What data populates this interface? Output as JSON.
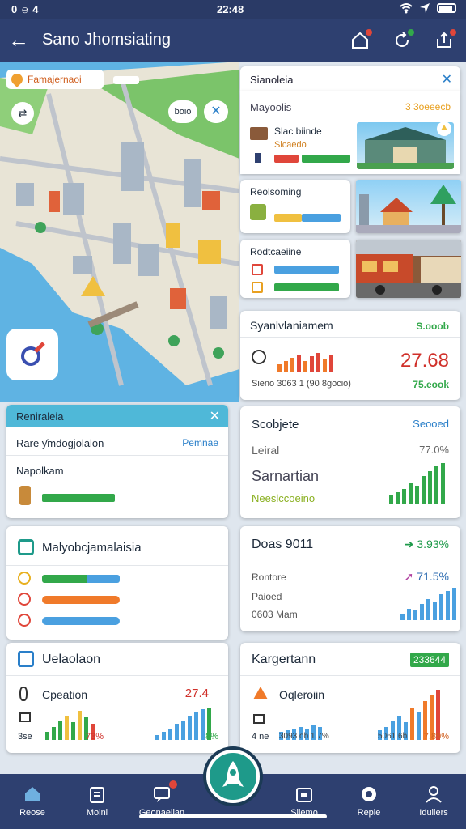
{
  "status": {
    "left": "0 ℮ 4",
    "time": "22:48"
  },
  "appbar": {
    "title": "Sano Jhomsiating"
  },
  "map": {
    "location_label": "Famajernaoi",
    "distance_label": "ƀoio",
    "badge": "—"
  },
  "nearby": {
    "title": "Sianoleia",
    "subtitle": "Mayoolis",
    "subtitle_value": "3 3oeeecb",
    "items": [
      {
        "name": "Slac biinde",
        "sub": "Sicaedo"
      },
      {
        "name": "Reolsoming"
      },
      {
        "name": "Rodtcaeiine"
      }
    ]
  },
  "stats": {
    "title": "Syanlvlaniamem",
    "title_value": "S.ooob",
    "big_value": "27.68",
    "footer": "Sieno 3063 1 (90 8gocio)",
    "footer_value": "75.eook"
  },
  "mid": {
    "title": "Reniraleia",
    "row1_label": "Rare ƴmdogjolalon",
    "row1_link": "Pemnae",
    "row2_label": "Napolkam"
  },
  "subj": {
    "title": "Scobjete",
    "title_value": "Seooed",
    "r1": "Leiral",
    "r1_value": "77.0%",
    "r2": "Sarnartian",
    "r3": "Neeslccoeino"
  },
  "list": {
    "title": "Malyobcjamalaisia"
  },
  "doas": {
    "title": "Doas 9011",
    "v1": "3.93%",
    "r1": "Rontore",
    "v2": "71.5%",
    "r2": "Paioed",
    "r3": "0603 Mam"
  },
  "bottom_left": {
    "title": "Uelaolaon",
    "sub": "Cpeation",
    "value": "27.4",
    "foot_left": "3se",
    "foot_mid": "73%",
    "foot_right": "8%"
  },
  "bottom_right": {
    "title": "Kargertann",
    "badge": "233644",
    "sub": "Oqleroiin",
    "foot1": "4 ne",
    "foot2": "3093 ob 1.7%",
    "foot3": "5061 6b",
    "foot4": "7.89%"
  },
  "nav": [
    {
      "label": "Reose",
      "icon": "home-icon"
    },
    {
      "label": "Moinl",
      "icon": "clipboard-icon"
    },
    {
      "label": "Geonaelian",
      "icon": "chat-icon"
    },
    {
      "label": "",
      "icon": "rocket-icon"
    },
    {
      "label": "Sliemo",
      "icon": "calendar-icon"
    },
    {
      "label": "Repie",
      "icon": "gear-icon"
    },
    {
      "label": "Iduliers",
      "icon": "user-icon"
    }
  ],
  "colors": {
    "appbar": "#2e4070",
    "accent_blue": "#2a7fc9",
    "green": "#32a84a",
    "orange": "#f07a2a",
    "red": "#e0463a"
  }
}
